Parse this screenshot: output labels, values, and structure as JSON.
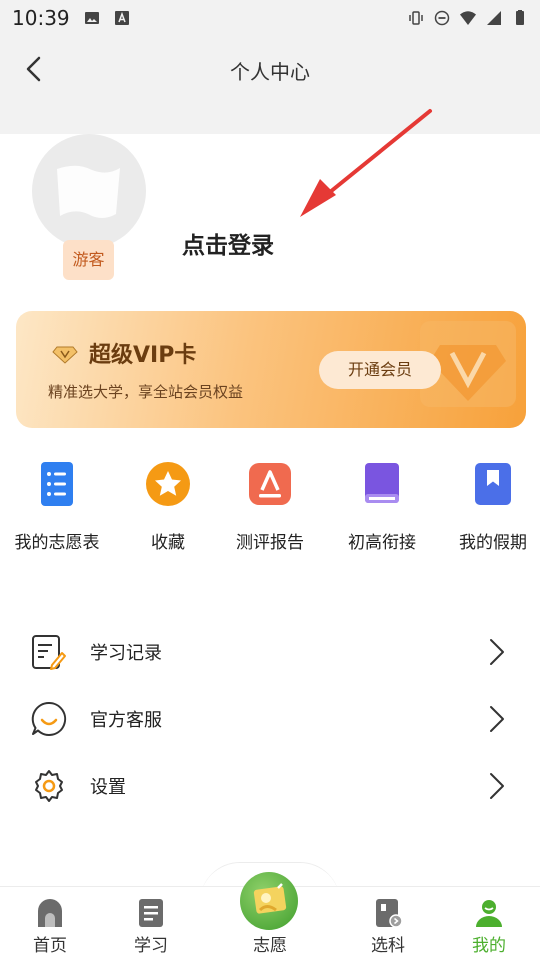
{
  "status_bar": {
    "time": "10:39"
  },
  "header": {
    "title": "个人中心"
  },
  "profile": {
    "guest_badge": "游客",
    "login_text": "点击登录"
  },
  "vip": {
    "title": "超级VIP卡",
    "subtitle": "精准选大学，享全站会员权益",
    "button": "开通会员"
  },
  "quick_actions": [
    {
      "label": "我的志愿表",
      "icon": "list-doc-icon",
      "color": "#2f7ff0"
    },
    {
      "label": "收藏",
      "icon": "star-icon",
      "color": "#f59a14"
    },
    {
      "label": "测评报告",
      "icon": "report-icon",
      "color": "#f06a4f"
    },
    {
      "label": "初高衔接",
      "icon": "book-icon",
      "color": "#7a55e0"
    },
    {
      "label": "我的假期",
      "icon": "bookmark-icon",
      "color": "#4b6fe8"
    }
  ],
  "menu": [
    {
      "label": "学习记录",
      "icon": "edit-note-icon"
    },
    {
      "label": "官方客服",
      "icon": "chat-icon"
    },
    {
      "label": "设置",
      "icon": "gear-icon"
    }
  ],
  "bottom_nav": [
    {
      "label": "首页",
      "icon": "home-icon"
    },
    {
      "label": "学习",
      "icon": "study-icon"
    },
    {
      "label": "志愿",
      "icon": "volunteer-icon"
    },
    {
      "label": "选科",
      "icon": "subject-icon"
    },
    {
      "label": "我的",
      "icon": "profile-icon",
      "active": true
    }
  ],
  "colors": {
    "accent_green": "#4caf2e",
    "vip_orange": "#f7a13a",
    "arrow_red": "#e53935"
  }
}
